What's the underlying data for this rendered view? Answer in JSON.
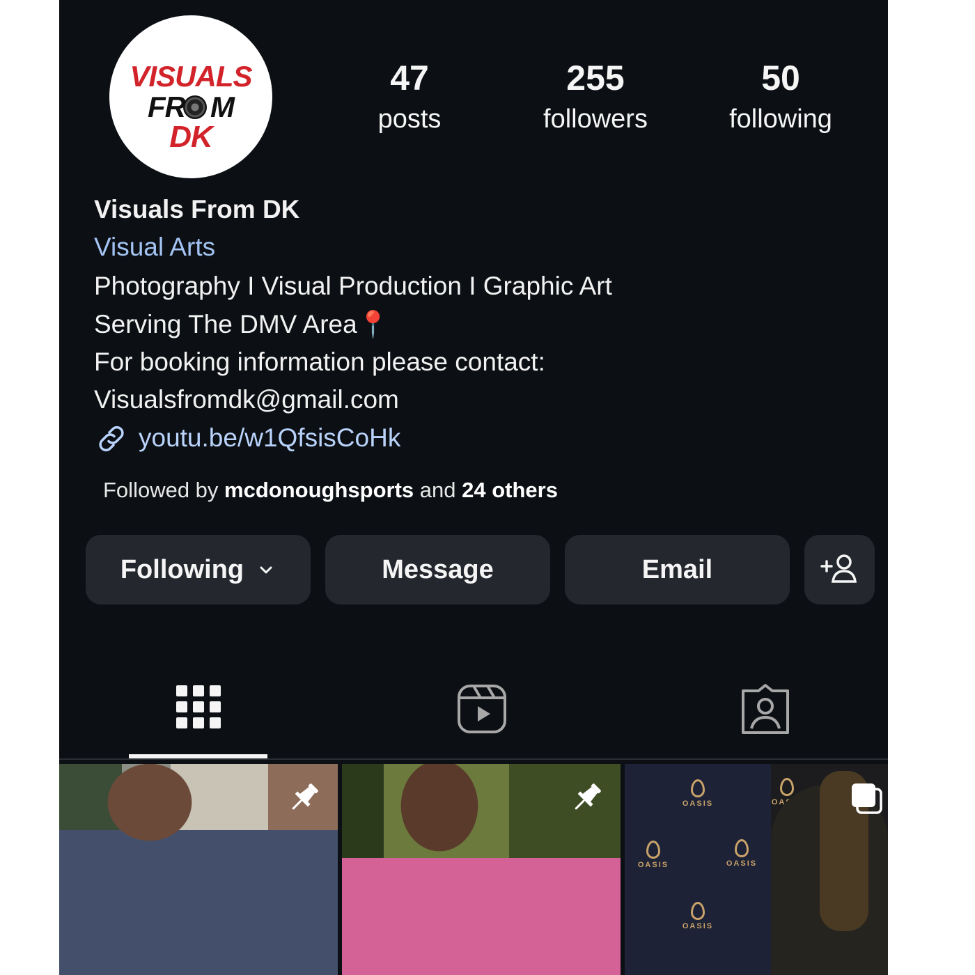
{
  "profile": {
    "logo_text": [
      "VISUALS",
      "FR",
      "M",
      "DK"
    ],
    "stats": [
      {
        "count": "47",
        "label": "posts"
      },
      {
        "count": "255",
        "label": "followers"
      },
      {
        "count": "50",
        "label": "following"
      }
    ],
    "name": "Visuals From DK",
    "category": "Visual Arts",
    "bio_lines": [
      "Photography I Visual Production I Graphic Art",
      "Serving The DMV Area📍",
      "For booking information please contact:",
      "Visualsfromdk@gmail.com"
    ],
    "link": "youtu.be/w1QfsisCoHk",
    "followed_by": {
      "prefix": "Followed by ",
      "user": "mcdonoughsports",
      "middle": " and ",
      "others": "24 others"
    }
  },
  "actions": {
    "following_label": "Following",
    "message_label": "Message",
    "email_label": "Email"
  },
  "tabs": [
    {
      "icon": "grid-icon",
      "active": true
    },
    {
      "icon": "reels-icon",
      "active": false
    },
    {
      "icon": "tagged-icon",
      "active": false
    }
  ],
  "posts": [
    {
      "badge": "pin-icon"
    },
    {
      "badge": "pin-icon"
    },
    {
      "badge": "carousel-icon",
      "backdrop_text": "OASIS"
    }
  ],
  "colors": {
    "background": "#0c0f14",
    "button": "#24272d",
    "link": "#a3c4f3",
    "logo_red": "#d2232a"
  }
}
